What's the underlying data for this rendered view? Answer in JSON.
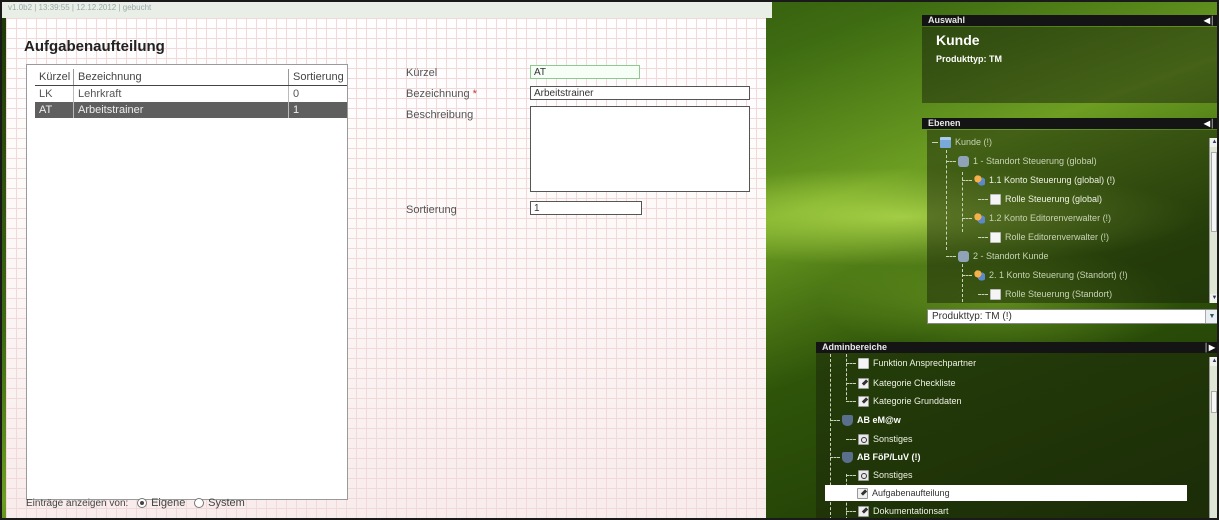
{
  "status_strip": "v1.0b2 | 13:39:55 | 12.12.2012 | gebucht",
  "page": {
    "title": "Aufgabenaufteilung"
  },
  "table": {
    "headers": [
      "Kürzel",
      "Bezeichnung",
      "Sortierung"
    ],
    "rows": [
      {
        "kuerzel": "LK",
        "bezeichnung": "Lehrkraft",
        "sortierung": "0",
        "selected": false
      },
      {
        "kuerzel": "AT",
        "bezeichnung": "Arbeitstrainer",
        "sortierung": "1",
        "selected": true
      }
    ]
  },
  "filter": {
    "label": "Einträge anzeigen von:",
    "options": [
      "Eigene",
      "System"
    ],
    "selected": "Eigene"
  },
  "form": {
    "kuerzel_label": "Kürzel",
    "kuerzel_value": "AT",
    "bezeichnung_label": "Bezeichnung",
    "required_mark": "*",
    "bezeichnung_value": "Arbeitstrainer",
    "beschreibung_label": "Beschreibung",
    "beschreibung_value": "",
    "sortierung_label": "Sortierung",
    "sortierung_value": "1"
  },
  "auswahl": {
    "title": "Auswahl",
    "kunde": "Kunde",
    "produkttyp": "Produkttyp: TM"
  },
  "ebenen": {
    "title": "Ebenen",
    "items": [
      {
        "label": "Kunde (!)",
        "icon": "folder-icon"
      },
      {
        "label": "1 - Standort Steuerung (global)",
        "icon": "database-icon"
      },
      {
        "label": "1.1 Konto Steuerung (global) (!)",
        "icon": "users-icon"
      },
      {
        "label": "Rolle Steuerung (global)",
        "icon": "document-icon"
      },
      {
        "label": "1.2 Konto Editorenverwalter (!)",
        "icon": "users-icon"
      },
      {
        "label": "Rolle Editorenverwalter (!)",
        "icon": "document-icon"
      },
      {
        "label": "2 - Standort Kunde",
        "icon": "database-icon"
      },
      {
        "label": "2. 1 Konto Steuerung (Standort) (!)",
        "icon": "users-icon"
      },
      {
        "label": "Rolle Steuerung (Standort)",
        "icon": "document-icon"
      }
    ],
    "select_value": "Produkttyp: TM (!)"
  },
  "adminbereiche": {
    "title": "Adminbereiche",
    "items": [
      {
        "label": "Funktion Ansprechpartner",
        "icon": "document-icon"
      },
      {
        "label": "Kategorie Checkliste",
        "icon": "edit-icon"
      },
      {
        "label": "Kategorie Grunddaten",
        "icon": "edit-icon"
      },
      {
        "label": "AB eM@w",
        "icon": "group-icon"
      },
      {
        "label": "Sonstiges",
        "icon": "magnifier-icon"
      },
      {
        "label": "AB FöP/LuV (!)",
        "icon": "group-icon"
      },
      {
        "label": "Sonstiges",
        "icon": "magnifier-icon"
      },
      {
        "label": "Aufgabenaufteilung",
        "icon": "edit-icon"
      },
      {
        "label": "Dokumentationsart",
        "icon": "edit-icon"
      }
    ]
  },
  "colors": {
    "selected_row": "#5f5f5f",
    "panel_header": "#141414",
    "required": "#cc3333",
    "focus_border": "#8ec98e"
  }
}
